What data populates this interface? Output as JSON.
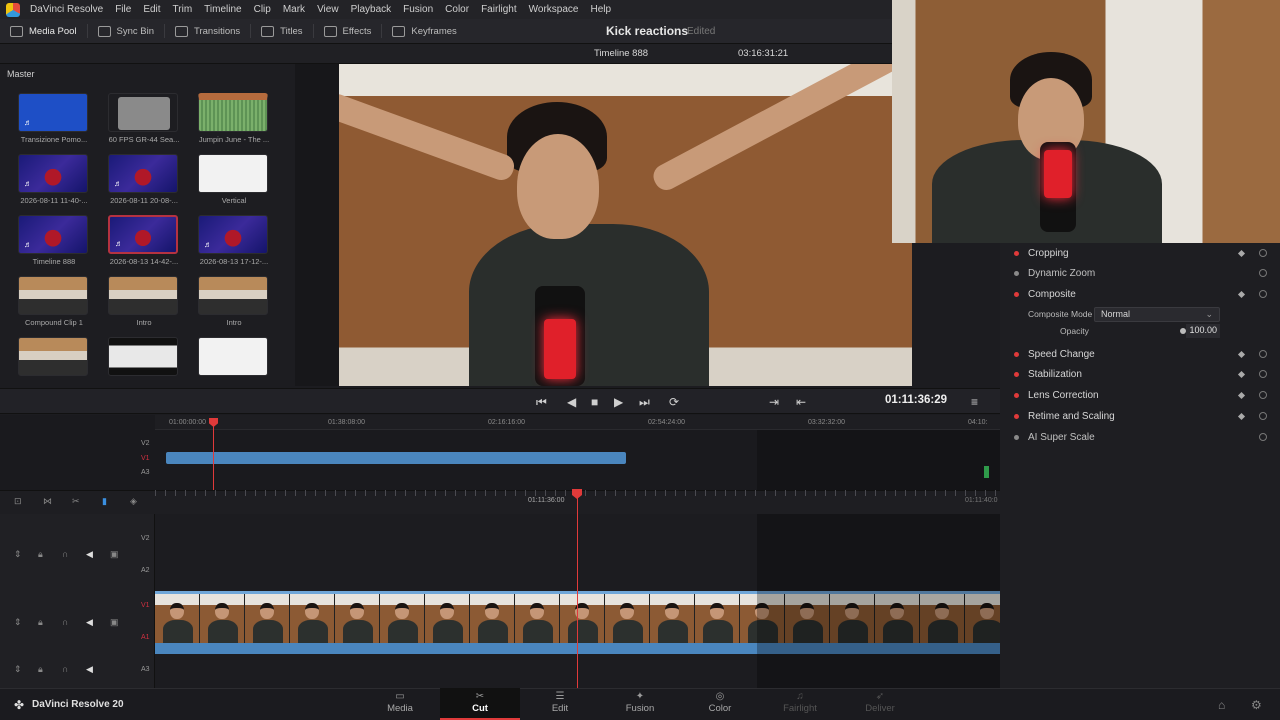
{
  "app": {
    "name": "DaVinci Resolve",
    "version_label": "DaVinci Resolve 20"
  },
  "menu": [
    "DaVinci Resolve",
    "File",
    "Edit",
    "Trim",
    "Timeline",
    "Clip",
    "Mark",
    "View",
    "Playback",
    "Fusion",
    "Color",
    "Fairlight",
    "Workspace",
    "Help"
  ],
  "toolbar": {
    "media_pool": "Media Pool",
    "sync_bin": "Sync Bin",
    "transitions": "Transitions",
    "titles": "Titles",
    "effects": "Effects",
    "keyframes": "Keyframes"
  },
  "project": {
    "title": "Kick reactions",
    "status": "Edited"
  },
  "viewer": {
    "timeline_name": "Timeline 888",
    "timecode": "03:16:31:21"
  },
  "pool": {
    "bin": "Master",
    "clips": [
      {
        "name": "Transizione Pomo...",
        "kind": "blue"
      },
      {
        "name": "60 FPS GR-44 Sea...",
        "kind": "folder"
      },
      {
        "name": "Jumpin June - The ...",
        "kind": "green"
      },
      {
        "name": "2026-08-11 11-40-...",
        "kind": "party"
      },
      {
        "name": "2026-08-11 20-08-...",
        "kind": "party"
      },
      {
        "name": "Vertical",
        "kind": "white"
      },
      {
        "name": "Timeline 888",
        "kind": "party"
      },
      {
        "name": "2026-08-13 14-42-...",
        "kind": "party",
        "selected": true
      },
      {
        "name": "2026-08-13 17-12-...",
        "kind": "party"
      },
      {
        "name": "Compound Clip 1",
        "kind": "person"
      },
      {
        "name": "Intro",
        "kind": "person"
      },
      {
        "name": "Intro",
        "kind": "person"
      },
      {
        "name": "",
        "kind": "person"
      },
      {
        "name": "",
        "kind": "screen"
      },
      {
        "name": "",
        "kind": "white"
      }
    ]
  },
  "inspector": {
    "sections": [
      {
        "label": "Cropping",
        "active": true
      },
      {
        "label": "Dynamic Zoom",
        "active": false
      },
      {
        "label": "Composite",
        "active": true
      },
      {
        "label": "Speed Change",
        "active": true
      },
      {
        "label": "Stabilization",
        "active": true
      },
      {
        "label": "Lens Correction",
        "active": true
      },
      {
        "label": "Retime and Scaling",
        "active": true
      },
      {
        "label": "AI Super Scale",
        "active": false
      }
    ],
    "composite_mode_label": "Composite Mode",
    "composite_mode_value": "Normal",
    "opacity_label": "Opacity",
    "opacity_value": "100.00"
  },
  "transport": {
    "timecode": "01:11:36:29"
  },
  "upper_ruler": [
    "01:00:00:00",
    "01:38:08:00",
    "02:16:16:00",
    "02:54:24:00",
    "03:32:32:00",
    "04:10:"
  ],
  "lower_ruler": {
    "center": "01:11:36:00",
    "right": "01:11:40:0"
  },
  "tracks": {
    "upper": [
      "V2",
      "V1",
      "A3"
    ],
    "lower": [
      "V2",
      "A2",
      "V1",
      "A1",
      "A3"
    ]
  },
  "pages": [
    {
      "label": "Media",
      "active": false,
      "dim": false
    },
    {
      "label": "Cut",
      "active": true,
      "dim": false
    },
    {
      "label": "Edit",
      "active": false,
      "dim": false
    },
    {
      "label": "Fusion",
      "active": false,
      "dim": false
    },
    {
      "label": "Color",
      "active": false,
      "dim": false
    },
    {
      "label": "Fairlight",
      "active": false,
      "dim": true
    },
    {
      "label": "Deliver",
      "active": false,
      "dim": true
    }
  ],
  "colors": {
    "accent": "#e03a3a",
    "clip_blue": "#4a86be",
    "panel": "#1e1e22"
  }
}
